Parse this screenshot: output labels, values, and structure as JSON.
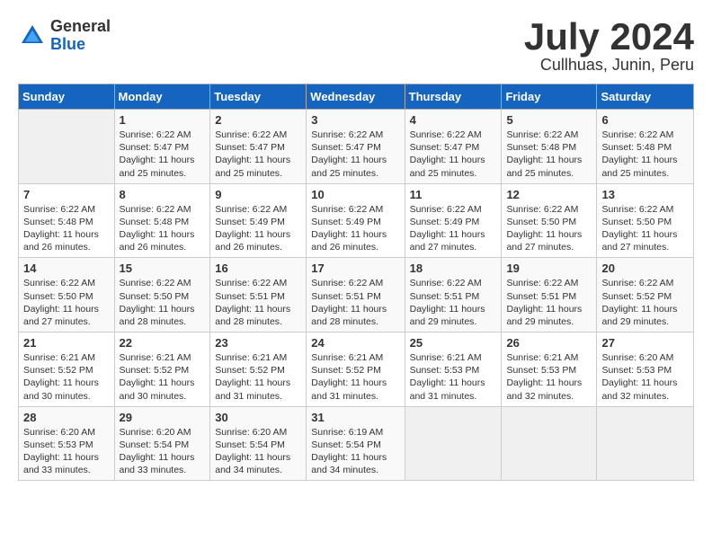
{
  "logo": {
    "general": "General",
    "blue": "Blue"
  },
  "title": "July 2024",
  "subtitle": "Cullhuas, Junin, Peru",
  "days_header": [
    "Sunday",
    "Monday",
    "Tuesday",
    "Wednesday",
    "Thursday",
    "Friday",
    "Saturday"
  ],
  "weeks": [
    [
      {
        "day": "",
        "info": ""
      },
      {
        "day": "1",
        "info": "Sunrise: 6:22 AM\nSunset: 5:47 PM\nDaylight: 11 hours\nand 25 minutes."
      },
      {
        "day": "2",
        "info": "Sunrise: 6:22 AM\nSunset: 5:47 PM\nDaylight: 11 hours\nand 25 minutes."
      },
      {
        "day": "3",
        "info": "Sunrise: 6:22 AM\nSunset: 5:47 PM\nDaylight: 11 hours\nand 25 minutes."
      },
      {
        "day": "4",
        "info": "Sunrise: 6:22 AM\nSunset: 5:47 PM\nDaylight: 11 hours\nand 25 minutes."
      },
      {
        "day": "5",
        "info": "Sunrise: 6:22 AM\nSunset: 5:48 PM\nDaylight: 11 hours\nand 25 minutes."
      },
      {
        "day": "6",
        "info": "Sunrise: 6:22 AM\nSunset: 5:48 PM\nDaylight: 11 hours\nand 25 minutes."
      }
    ],
    [
      {
        "day": "7",
        "info": "Sunrise: 6:22 AM\nSunset: 5:48 PM\nDaylight: 11 hours\nand 26 minutes."
      },
      {
        "day": "8",
        "info": "Sunrise: 6:22 AM\nSunset: 5:48 PM\nDaylight: 11 hours\nand 26 minutes."
      },
      {
        "day": "9",
        "info": "Sunrise: 6:22 AM\nSunset: 5:49 PM\nDaylight: 11 hours\nand 26 minutes."
      },
      {
        "day": "10",
        "info": "Sunrise: 6:22 AM\nSunset: 5:49 PM\nDaylight: 11 hours\nand 26 minutes."
      },
      {
        "day": "11",
        "info": "Sunrise: 6:22 AM\nSunset: 5:49 PM\nDaylight: 11 hours\nand 27 minutes."
      },
      {
        "day": "12",
        "info": "Sunrise: 6:22 AM\nSunset: 5:50 PM\nDaylight: 11 hours\nand 27 minutes."
      },
      {
        "day": "13",
        "info": "Sunrise: 6:22 AM\nSunset: 5:50 PM\nDaylight: 11 hours\nand 27 minutes."
      }
    ],
    [
      {
        "day": "14",
        "info": "Sunrise: 6:22 AM\nSunset: 5:50 PM\nDaylight: 11 hours\nand 27 minutes."
      },
      {
        "day": "15",
        "info": "Sunrise: 6:22 AM\nSunset: 5:50 PM\nDaylight: 11 hours\nand 28 minutes."
      },
      {
        "day": "16",
        "info": "Sunrise: 6:22 AM\nSunset: 5:51 PM\nDaylight: 11 hours\nand 28 minutes."
      },
      {
        "day": "17",
        "info": "Sunrise: 6:22 AM\nSunset: 5:51 PM\nDaylight: 11 hours\nand 28 minutes."
      },
      {
        "day": "18",
        "info": "Sunrise: 6:22 AM\nSunset: 5:51 PM\nDaylight: 11 hours\nand 29 minutes."
      },
      {
        "day": "19",
        "info": "Sunrise: 6:22 AM\nSunset: 5:51 PM\nDaylight: 11 hours\nand 29 minutes."
      },
      {
        "day": "20",
        "info": "Sunrise: 6:22 AM\nSunset: 5:52 PM\nDaylight: 11 hours\nand 29 minutes."
      }
    ],
    [
      {
        "day": "21",
        "info": "Sunrise: 6:21 AM\nSunset: 5:52 PM\nDaylight: 11 hours\nand 30 minutes."
      },
      {
        "day": "22",
        "info": "Sunrise: 6:21 AM\nSunset: 5:52 PM\nDaylight: 11 hours\nand 30 minutes."
      },
      {
        "day": "23",
        "info": "Sunrise: 6:21 AM\nSunset: 5:52 PM\nDaylight: 11 hours\nand 31 minutes."
      },
      {
        "day": "24",
        "info": "Sunrise: 6:21 AM\nSunset: 5:52 PM\nDaylight: 11 hours\nand 31 minutes."
      },
      {
        "day": "25",
        "info": "Sunrise: 6:21 AM\nSunset: 5:53 PM\nDaylight: 11 hours\nand 31 minutes."
      },
      {
        "day": "26",
        "info": "Sunrise: 6:21 AM\nSunset: 5:53 PM\nDaylight: 11 hours\nand 32 minutes."
      },
      {
        "day": "27",
        "info": "Sunrise: 6:20 AM\nSunset: 5:53 PM\nDaylight: 11 hours\nand 32 minutes."
      }
    ],
    [
      {
        "day": "28",
        "info": "Sunrise: 6:20 AM\nSunset: 5:53 PM\nDaylight: 11 hours\nand 33 minutes."
      },
      {
        "day": "29",
        "info": "Sunrise: 6:20 AM\nSunset: 5:54 PM\nDaylight: 11 hours\nand 33 minutes."
      },
      {
        "day": "30",
        "info": "Sunrise: 6:20 AM\nSunset: 5:54 PM\nDaylight: 11 hours\nand 34 minutes."
      },
      {
        "day": "31",
        "info": "Sunrise: 6:19 AM\nSunset: 5:54 PM\nDaylight: 11 hours\nand 34 minutes."
      },
      {
        "day": "",
        "info": ""
      },
      {
        "day": "",
        "info": ""
      },
      {
        "day": "",
        "info": ""
      }
    ]
  ]
}
